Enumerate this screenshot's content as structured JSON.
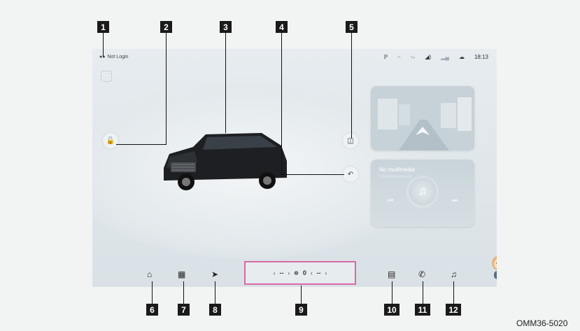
{
  "status_bar": {
    "login_text": "Not Login",
    "icons": [
      "bluetooth-icon",
      "wifi-icon",
      "hotspot-icon",
      "volume-icon",
      "signal-icon",
      "cloud-icon"
    ],
    "time": "18:13"
  },
  "media": {
    "title": "No multimedia",
    "subtitle": "Unmultimedia left"
  },
  "climate": {
    "left_temp": "--",
    "fan_level": "0",
    "right_temp": "--"
  },
  "dock": {
    "left_icons": [
      "home-icon",
      "apps-icon",
      "navigation-icon"
    ],
    "right_icons": [
      "car-icon",
      "phone-icon",
      "music-icon"
    ]
  },
  "callouts": [
    "1",
    "2",
    "3",
    "4",
    "5",
    "6",
    "7",
    "8",
    "9",
    "10",
    "11",
    "12"
  ],
  "image_code": "OMM36-5020",
  "colors": {
    "highlight_border": "#d86aa6",
    "callout_bg": "#1a1a1a"
  }
}
